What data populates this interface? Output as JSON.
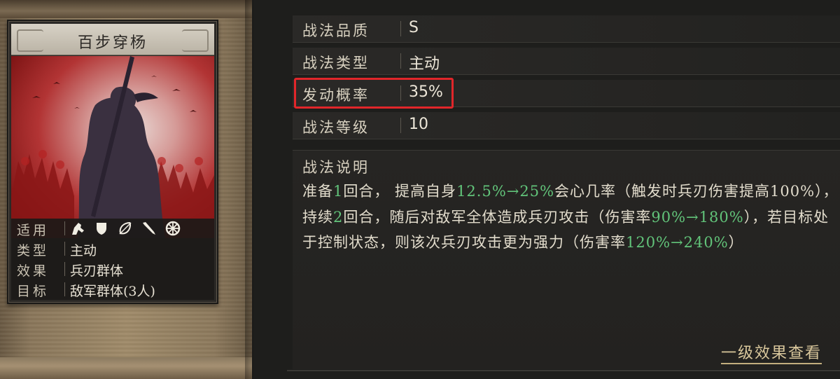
{
  "card": {
    "title": "百步穿杨",
    "info": [
      {
        "label": "适用",
        "value": ""
      },
      {
        "label": "类型",
        "value": "主动"
      },
      {
        "label": "效果",
        "value": "兵刃群体"
      },
      {
        "label": "目标",
        "value": "敌军群体(3人)"
      }
    ],
    "unit_icons": [
      "cavalry-icon",
      "shield-infantry-icon",
      "bow-archer-icon",
      "spear-icon",
      "siege-wheel-icon"
    ]
  },
  "attributes": [
    {
      "label": "战法品质",
      "value": "S"
    },
    {
      "label": "战法类型",
      "value": "主动"
    },
    {
      "label": "发动概率",
      "value": "35%"
    },
    {
      "label": "战法等级",
      "value": "10"
    }
  ],
  "description": {
    "title": "战法说明",
    "segments": [
      {
        "text": "准备",
        "hl": false
      },
      {
        "text": "1",
        "hl": true
      },
      {
        "text": "回合， 提高自身",
        "hl": false
      },
      {
        "text": "12.5%→25%",
        "hl": true
      },
      {
        "text": "会心几率（触发时兵刃伤害提高100%），持续",
        "hl": false
      },
      {
        "text": "2",
        "hl": true
      },
      {
        "text": "回合，随后对敌军全体造成兵刃攻击（伤害率",
        "hl": false
      },
      {
        "text": "90%→180%",
        "hl": true
      },
      {
        "text": "），若目标处于控制状态，则该次兵刃攻击更为强力（伤害率",
        "hl": false
      },
      {
        "text": "120%→240%",
        "hl": true
      },
      {
        "text": "）",
        "hl": false
      }
    ]
  },
  "link": {
    "label": "一级效果查看"
  },
  "colors": {
    "highlight": "#62c47a",
    "annotation_box": "#e1262a",
    "link": "#d9c79c"
  }
}
